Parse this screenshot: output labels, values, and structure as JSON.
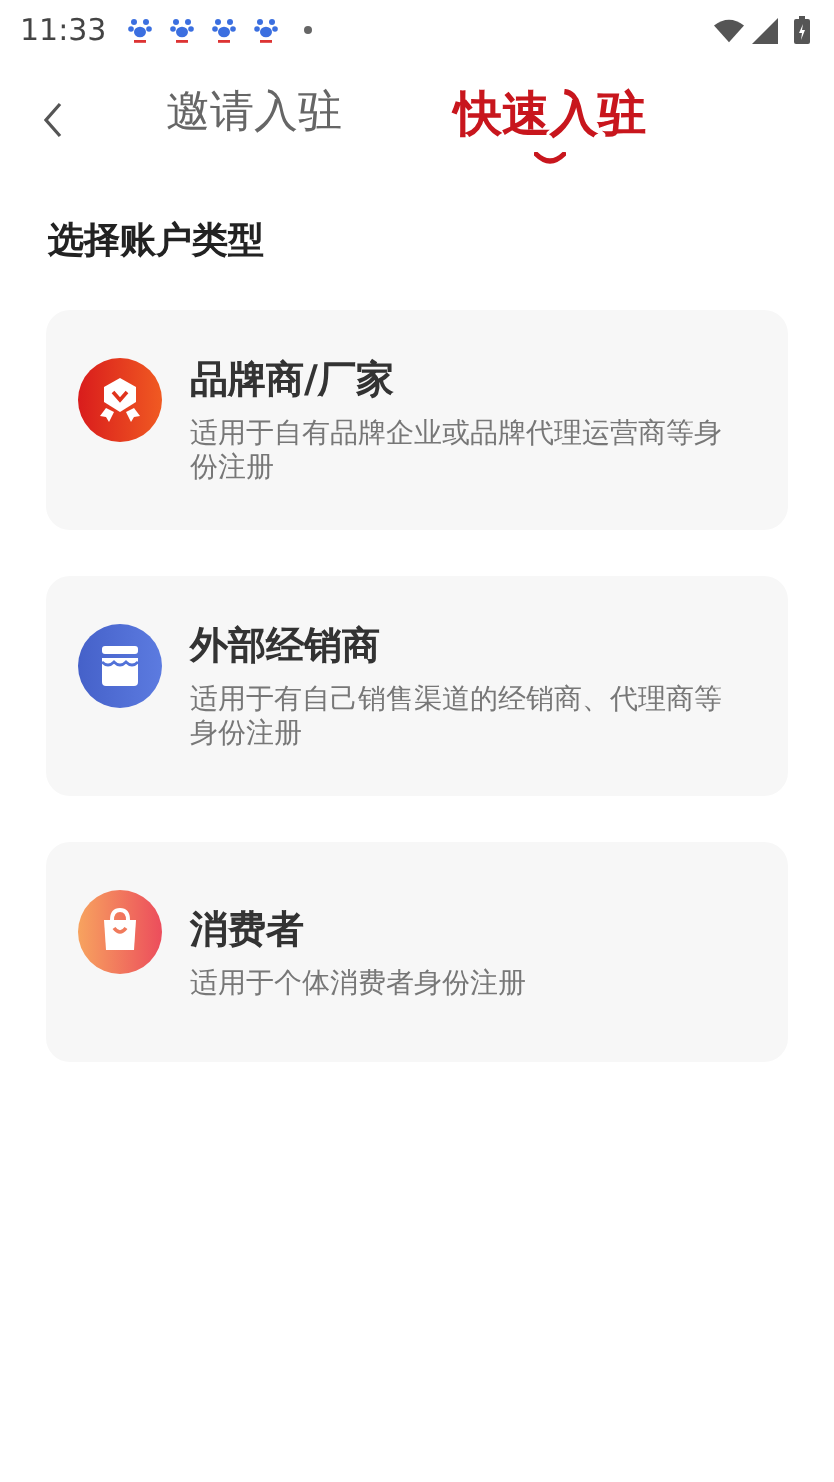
{
  "status_bar": {
    "time": "11:33"
  },
  "tabs": [
    {
      "label": "邀请入驻",
      "selected": false
    },
    {
      "label": "快速入驻",
      "selected": true
    }
  ],
  "section_title": "选择账户类型",
  "account_types": [
    {
      "kind": "brand",
      "title": "品牌商/厂家",
      "description": "适用于自有品牌企业或品牌代理运营商等身份注册"
    },
    {
      "kind": "distributor",
      "title": "外部经销商",
      "description": "适用于有自己销售渠道的经销商、代理商等身份注册"
    },
    {
      "kind": "consumer",
      "title": "消费者",
      "description": "适用于个体消费者身份注册"
    }
  ]
}
